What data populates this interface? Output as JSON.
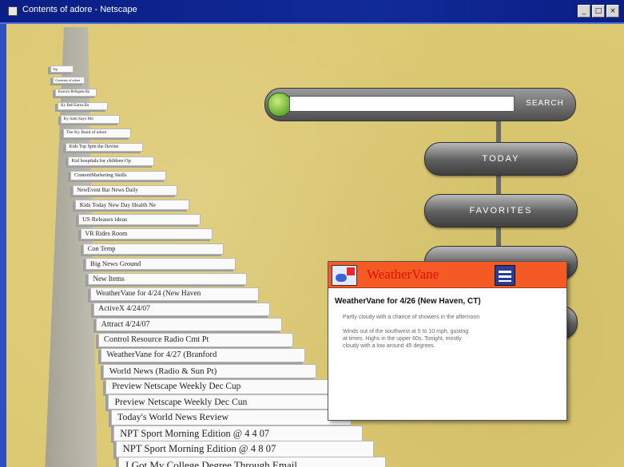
{
  "window": {
    "title": "Contents of adore - Netscape",
    "buttons": [
      "_",
      "□",
      "×"
    ]
  },
  "icons": {
    "window": "app-icon",
    "search": "green-orb-icon",
    "popup_left": "weather-icon",
    "popup_right": "news-logo-icon"
  },
  "tree": {
    "items": [
      "Top",
      "Contents of adore",
      "Kosovo Refugees Ra",
      "Ky Bell Earns Ba",
      "Ky Sam Says Mo",
      "The Ky Band of adore",
      "Kids Top Spin the Devine",
      "Kid hospitals for children Op",
      "ContentMarketing Skills",
      "NewEvent Bar News Daily",
      "Kids Today New Day Health Ne",
      "US Releases ideas",
      "VR Rides Room",
      "Con Temp",
      "Big News Ground",
      "New Items",
      "WeatherVane for 4/24 (New Haven",
      "ActiveX 4/24/07",
      "Attract 4/24/07",
      "Control Resource Radio Cmt Pt",
      "WeatherVane for 4/27 (Branford",
      "World News (Radio & Sun Pt)",
      "Preview Netscape Weekly Dec Cup",
      "Preview Netscape Weekly Dec Cun",
      "Today's World News Review",
      "NPT Sport Morning Edition @ 4 4 07",
      "NPT Sport Morning Edition @ 4 8 07",
      "I Got My College Degree Through Email"
    ]
  },
  "search": {
    "value": "",
    "button_label": "SEARCH"
  },
  "nav_pills": [
    "TODAY",
    "FAVORITES",
    "",
    ""
  ],
  "popup": {
    "title": "WeatherVane",
    "heading": "WeatherVane for 4/26 (New Haven, CT)",
    "lines": [
      "Partly cloudy with a chance of showers in the afternoon",
      "Winds out of the southwest at 5 to 10 mph, gusting",
      "at times. Highs in the upper 60s. Tonight, mostly",
      "cloudy with a low around 45 degrees."
    ]
  },
  "colors": {
    "background": "#dcc972",
    "titlebar": "#0b1e86",
    "popup_header": "#f55a25",
    "popup_title": "#d61400"
  }
}
